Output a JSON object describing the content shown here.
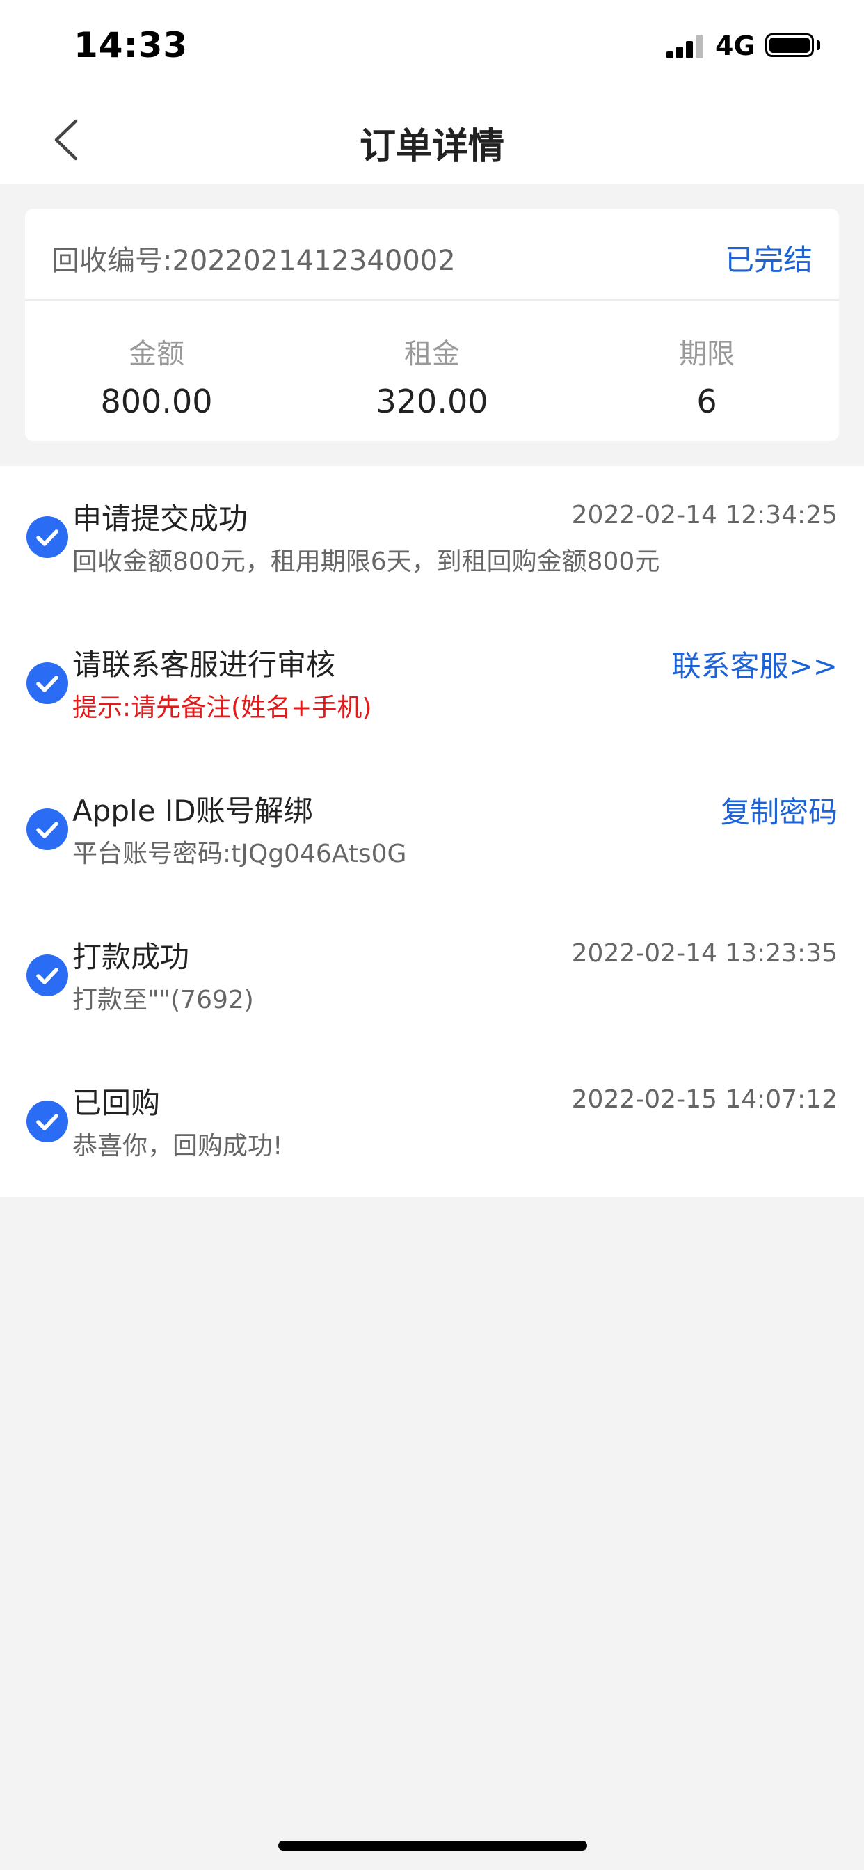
{
  "status_bar": {
    "time": "14:33",
    "network": "4G"
  },
  "nav": {
    "title": "订单详情"
  },
  "order": {
    "number_text": "回收编号:2022021412340002",
    "status": "已完结",
    "stats": [
      {
        "label": "金额",
        "value": "800.00"
      },
      {
        "label": "租金",
        "value": "320.00"
      },
      {
        "label": "期限",
        "value": "6"
      }
    ]
  },
  "timeline": {
    "steps": [
      {
        "title": "申请提交成功",
        "desc": "回收金额800元，租用期限6天，到租回购金额800元",
        "time": "2022-02-14 12:34:25"
      },
      {
        "title": "请联系客服进行审核",
        "desc": "提示:请先备注(姓名+手机)",
        "action": "联系客服>>"
      },
      {
        "title": "Apple ID账号解绑",
        "desc": "平台账号密码:tJQg046Ats0G",
        "action": "复制密码"
      },
      {
        "title": "打款成功",
        "desc": "打款至\"\"(7692)",
        "time": "2022-02-14 13:23:35"
      },
      {
        "title": "已回购",
        "desc": "恭喜你，回购成功!",
        "time": "2022-02-15 14:07:12"
      }
    ]
  }
}
